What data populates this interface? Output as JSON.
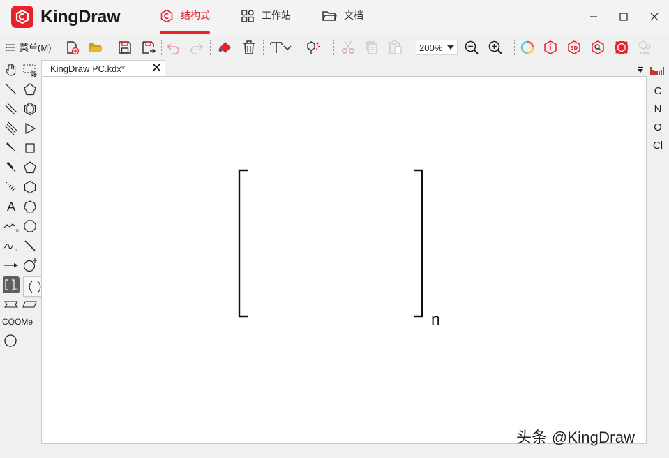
{
  "app": {
    "brand": "KingDraw",
    "accent_color": "#e8212b"
  },
  "nav_tabs": [
    {
      "label": "结构式",
      "icon": "structure-icon",
      "active": true
    },
    {
      "label": "工作站",
      "icon": "grid-icon",
      "active": false
    },
    {
      "label": "文档",
      "icon": "folder-icon",
      "active": false
    }
  ],
  "window_controls": [
    "minimize-icon",
    "maximize-icon",
    "close-icon"
  ],
  "toolbar": {
    "menu_label": "菜单(M)",
    "zoom_value": "200%",
    "buttons": [
      "new-file",
      "open-folder",
      "save",
      "save-as",
      "undo",
      "redo",
      "eraser",
      "delete",
      "text",
      "clean-structure",
      "cut",
      "copy",
      "paste",
      "zoom-out",
      "zoom-in",
      "ring-color",
      "info",
      "3d",
      "search-structure",
      "image-recognition",
      "name"
    ]
  },
  "document_tab": {
    "title": "KingDraw PC.kdx*"
  },
  "left_tools": {
    "text_tool_label": "A",
    "group_label": "COOMe"
  },
  "bracket_flyout": {
    "options": [
      "( )",
      "{ }",
      "[ ]",
      "[ ]n"
    ],
    "selected": "[ ]n"
  },
  "canvas": {
    "bracket_subscript": "n"
  },
  "elements": [
    "C",
    "N",
    "O",
    "Cl"
  ],
  "watermark": "头条 @KingDraw"
}
